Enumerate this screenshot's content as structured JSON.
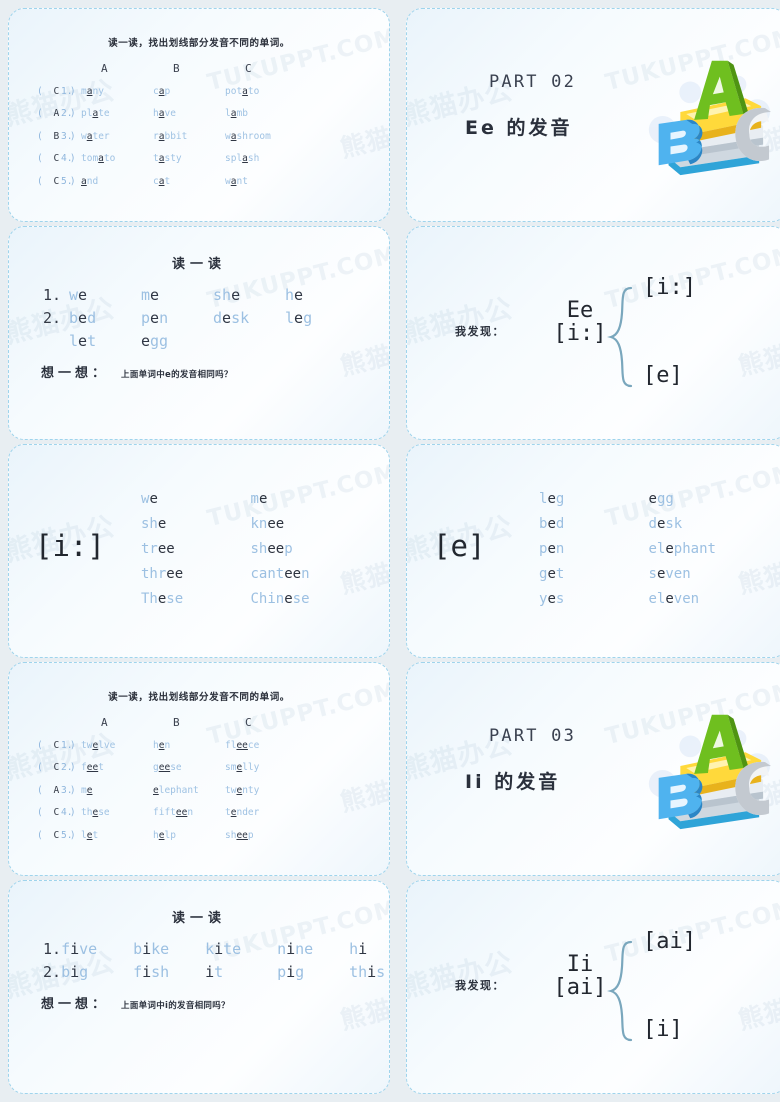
{
  "watermark": {
    "line1": "熊猫办公",
    "line2": "TUKUPPT.COM",
    "line3": "熊猫办公"
  },
  "slides": [
    {
      "id": "exercise-aa",
      "type": "exercise",
      "title": "读一读，找出划线部分发音不同的单词。",
      "columns": [
        "A",
        "B",
        "C"
      ],
      "rows": [
        {
          "answer": "C",
          "num": "1.",
          "a": [
            "m",
            "a",
            "ny"
          ],
          "b": [
            "c",
            "a",
            "p"
          ],
          "c": [
            "pot",
            "a",
            "to"
          ]
        },
        {
          "answer": "A",
          "num": "2.",
          "a": [
            "pl",
            "a",
            "te"
          ],
          "b": [
            "h",
            "a",
            "ve"
          ],
          "c": [
            "l",
            "a",
            "mb"
          ]
        },
        {
          "answer": "B",
          "num": "3.",
          "a": [
            "w",
            "a",
            "ter"
          ],
          "b": [
            "r",
            "a",
            "bbit"
          ],
          "c": [
            "w",
            "a",
            "shroom"
          ]
        },
        {
          "answer": "C",
          "num": "4.",
          "a": [
            "tom",
            "a",
            "to"
          ],
          "b": [
            "t",
            "a",
            "sty"
          ],
          "c": [
            "spl",
            "a",
            "sh"
          ]
        },
        {
          "answer": "C",
          "num": "5.",
          "a": [
            "",
            "a",
            "nd"
          ],
          "b": [
            "c",
            "a",
            "t"
          ],
          "c": [
            "w",
            "a",
            "nt"
          ]
        }
      ]
    },
    {
      "id": "part-02",
      "type": "part",
      "part_label": "PART 02",
      "part_title": "Ee 的发音",
      "illustration": "abc-books-icon"
    },
    {
      "id": "read-e",
      "type": "read",
      "title": "读一读",
      "lines": [
        {
          "num": "1.",
          "words": [
            [
              "w",
              "e",
              ""
            ],
            [
              "m",
              "e",
              ""
            ],
            [
              "sh",
              "e",
              ""
            ],
            [
              "h",
              "e",
              ""
            ]
          ]
        },
        {
          "num": "2.",
          "words": [
            [
              "b",
              "e",
              "d"
            ],
            [
              "p",
              "e",
              "n"
            ],
            [
              "d",
              "e",
              "sk"
            ],
            [
              "l",
              "e",
              "g"
            ]
          ]
        },
        {
          "num": "",
          "words": [
            [
              "l",
              "e",
              "t"
            ],
            [
              "",
              "e",
              "gg"
            ]
          ]
        }
      ],
      "think_label": "想一想：",
      "think_question": "上面单词中e的发音相同吗？"
    },
    {
      "id": "discover-ee",
      "type": "discovery",
      "label": "我发现：",
      "letter_line1": "Ee",
      "letter_line2": "[i:]",
      "out_top": "[i:]",
      "out_bottom": "[e]"
    },
    {
      "id": "phoneme-i-long",
      "type": "phoneme",
      "symbol": "[i:]",
      "col1": [
        [
          "w",
          "e",
          ""
        ],
        [
          "sh",
          "e",
          ""
        ],
        [
          "tr",
          "ee",
          ""
        ],
        [
          "thr",
          "ee",
          ""
        ],
        [
          "Th",
          "e",
          "se"
        ]
      ],
      "col2": [
        [
          "m",
          "e",
          ""
        ],
        [
          "kn",
          "ee",
          ""
        ],
        [
          "sh",
          "ee",
          "p"
        ],
        [
          "cant",
          "ee",
          "n"
        ],
        [
          "Chin",
          "e",
          "se"
        ]
      ]
    },
    {
      "id": "phoneme-e-short",
      "type": "phoneme",
      "symbol": "[e]",
      "col1": [
        [
          "l",
          "e",
          "g"
        ],
        [
          "b",
          "e",
          "d"
        ],
        [
          "p",
          "e",
          "n"
        ],
        [
          "g",
          "e",
          "t"
        ],
        [
          "y",
          "e",
          "s"
        ]
      ],
      "col2": [
        [
          "",
          "e",
          "gg"
        ],
        [
          "d",
          "e",
          "sk"
        ],
        [
          "el",
          "e",
          "phant"
        ],
        [
          "s",
          "e",
          "ven"
        ],
        [
          "el",
          "e",
          "ven"
        ]
      ]
    },
    {
      "id": "exercise-ee",
      "type": "exercise",
      "title": "读一读，找出划线部分发音不同的单词。",
      "columns": [
        "A",
        "B",
        "C"
      ],
      "rows": [
        {
          "answer": "C",
          "num": "1.",
          "a": [
            "tw",
            "e",
            "lve"
          ],
          "b": [
            "h",
            "e",
            "n"
          ],
          "c": [
            "fl",
            "ee",
            "ce"
          ]
        },
        {
          "answer": "C",
          "num": "2.",
          "a": [
            "f",
            "ee",
            "t"
          ],
          "b": [
            "g",
            "ee",
            "se"
          ],
          "c": [
            "sm",
            "e",
            "lly"
          ]
        },
        {
          "answer": "A",
          "num": "3.",
          "a": [
            "m",
            "e",
            ""
          ],
          "b": [
            "",
            "e",
            "lephant"
          ],
          "c": [
            "tw",
            "e",
            "nty"
          ]
        },
        {
          "answer": "C",
          "num": "4.",
          "a": [
            "th",
            "e",
            "se"
          ],
          "b": [
            "fift",
            "ee",
            "n"
          ],
          "c": [
            "t",
            "e",
            "nder"
          ]
        },
        {
          "answer": "C",
          "num": "5.",
          "a": [
            "l",
            "e",
            "t"
          ],
          "b": [
            "h",
            "e",
            "lp"
          ],
          "c": [
            "sh",
            "ee",
            "p"
          ]
        }
      ]
    },
    {
      "id": "part-03",
      "type": "part",
      "part_label": "PART 03",
      "part_title": "Ii 的发音",
      "illustration": "abc-books-icon"
    },
    {
      "id": "read-i",
      "type": "read",
      "title": "读一读",
      "lines": [
        {
          "num": "1.",
          "words": [
            [
              "f",
              "i",
              "ve"
            ],
            [
              "b",
              "i",
              "ke"
            ],
            [
              "k",
              "i",
              "te"
            ],
            [
              "n",
              "i",
              "ne"
            ],
            [
              "h",
              "i",
              ""
            ]
          ]
        },
        {
          "num": "2.",
          "words": [
            [
              "b",
              "i",
              "g"
            ],
            [
              "f",
              "i",
              "sh"
            ],
            [
              "",
              "i",
              "t"
            ],
            [
              "p",
              "i",
              "g"
            ],
            [
              "th",
              "i",
              "s"
            ]
          ]
        }
      ],
      "think_label": "想一想：",
      "think_question": "上面单词中i的发音相同吗？"
    },
    {
      "id": "discover-ii",
      "type": "discovery",
      "label": "我发现：",
      "letter_line1": "Ii",
      "letter_line2": "[ai]",
      "out_top": "[ai]",
      "out_bottom": "[i]"
    }
  ],
  "colors": {
    "page_background": "#e8eef2",
    "slide_border": "#9fd4ec",
    "slide_background": "#f4fafd",
    "word_light": "#9cc0e2",
    "word_dark": "#2d333f",
    "text_dark": "#2a2f3a"
  }
}
